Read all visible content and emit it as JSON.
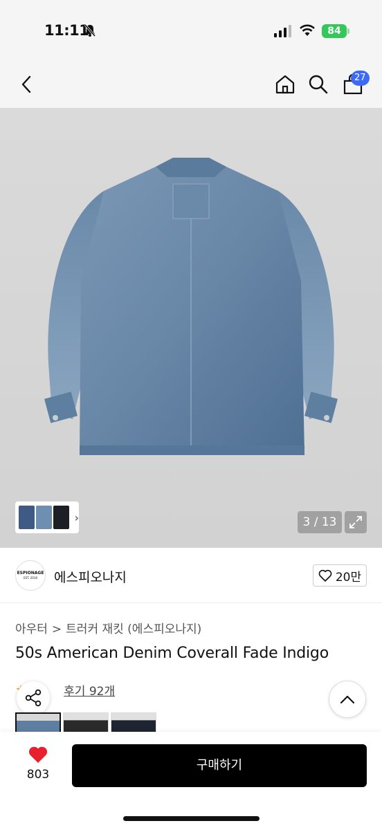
{
  "status_bar": {
    "time": "11:11",
    "battery": "84"
  },
  "nav": {
    "cart_count": "27"
  },
  "gallery": {
    "counter": "3 / 13",
    "thumb_chevron": "›"
  },
  "brand": {
    "logo_text": "ESPIONAGE",
    "logo_sub": "EST. 2018",
    "name": "에스피오나지",
    "likes": "20만"
  },
  "product": {
    "category": [
      "아우터",
      "트러커 재킷 (에스피오나지)"
    ],
    "category_sep": ">",
    "title": "50s American Denim Coverall Fade Indigo",
    "reviews": "후기 92개",
    "color_options": [
      {
        "name": "fade-indigo",
        "color": "#5f7fa0"
      },
      {
        "name": "black",
        "color": "#2a2a2a"
      },
      {
        "name": "navy",
        "color": "#1e2430"
      }
    ]
  },
  "bottom_bar": {
    "wish_count": "803",
    "buy_label": "구매하기"
  },
  "colors": {
    "accent_badge": "#3d6af5",
    "heart": "#e8212e",
    "battery": "#34c759",
    "star": "#f7a21b"
  }
}
